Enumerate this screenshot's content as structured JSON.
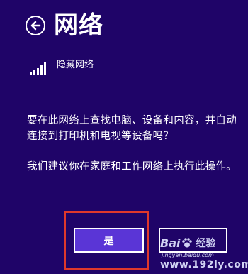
{
  "header": {
    "title": "网络",
    "back_icon": "arrow-left-icon"
  },
  "network": {
    "name": "隐藏网络",
    "signal_icon": "wifi-signal-icon",
    "signal_bars": 5
  },
  "content": {
    "paragraph1": "要在此网络上查找电脑、设备和内容，并自动连接到打印机和电视等设备吗？",
    "paragraph2": "我们建议你在家庭和工作网络上执行此操作。"
  },
  "buttons": {
    "yes_label": "是",
    "no_label": ""
  },
  "watermark": {
    "brand": "Bai",
    "brand2": "经验",
    "small": "jingyan.baidu.com",
    "url": "www.192ly.com"
  },
  "colors": {
    "background": "#1f0468",
    "accent": "#5a35d6",
    "highlight": "#e0382b"
  }
}
